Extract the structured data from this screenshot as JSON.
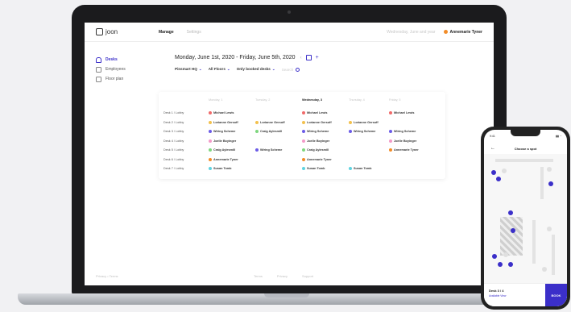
{
  "app": {
    "logo_text": "joon"
  },
  "nav": {
    "manage": "Manage",
    "settings": "Settings"
  },
  "header": {
    "faded_text": "Wednesday, June and year",
    "user_name": "Annemarie Tyner"
  },
  "sidebar": {
    "items": [
      {
        "label": "Desks"
      },
      {
        "label": "Employees"
      },
      {
        "label": "Floor plan"
      }
    ]
  },
  "footer": {
    "left": "Privacy • Terms",
    "center": [
      "Terms",
      "Privacy",
      "Support"
    ]
  },
  "main": {
    "date_range": "Monday, June 1st, 2020 - Friday, June 5th, 2020",
    "filters": [
      "Pinsmart HQ",
      "All Floors",
      "Only booked desks",
      "Search"
    ]
  },
  "table": {
    "columns": [
      "Monday, 1",
      "Tuesday, 2",
      "Wednesday, 3",
      "Thursday, 4",
      "Friday, 5"
    ],
    "rows": [
      {
        "label": "Desk 1 / Lobby",
        "cells": [
          {
            "name": "Michael Lewis",
            "color": "#f06a6a"
          },
          null,
          {
            "name": "Michael Lewis",
            "color": "#f06a6a"
          },
          null,
          {
            "name": "Michael Lewis",
            "color": "#f06a6a"
          }
        ]
      },
      {
        "label": "Desk 2 / Lobby",
        "cells": [
          {
            "name": "Lorianne Gersoff",
            "color": "#f2c14e"
          },
          {
            "name": "Lorianne Gersoff",
            "color": "#f2c14e"
          },
          {
            "name": "Lorianne Gersoff",
            "color": "#f2c14e"
          },
          {
            "name": "Lorianne Gersoff",
            "color": "#f2c14e"
          },
          null
        ]
      },
      {
        "label": "Desk 3 / Lobby",
        "cells": [
          {
            "name": "Wiring Scheme",
            "color": "#6c5ce7"
          },
          {
            "name": "Craig Aylesmill",
            "color": "#7ed67e"
          },
          {
            "name": "Wiring Scheme",
            "color": "#6c5ce7"
          },
          {
            "name": "Wiring Scheme",
            "color": "#6c5ce7"
          },
          {
            "name": "Wiring Scheme",
            "color": "#6c5ce7"
          }
        ]
      },
      {
        "label": "Desk 4 / Lobby",
        "cells": [
          {
            "name": "Joelle Boyinger",
            "color": "#f39ac8"
          },
          null,
          {
            "name": "Joelle Boyinger",
            "color": "#f39ac8"
          },
          null,
          {
            "name": "Joelle Boyinger",
            "color": "#f39ac8"
          }
        ]
      },
      {
        "label": "Desk 5 / Lobby",
        "cells": [
          {
            "name": "Craig Aylesmill",
            "color": "#7ed67e"
          },
          {
            "name": "Wiring Scheme",
            "color": "#6c5ce7"
          },
          {
            "name": "Craig Aylesmill",
            "color": "#7ed67e"
          },
          null,
          {
            "name": "Annemarie Tyner",
            "color": "#f28c28"
          }
        ]
      },
      {
        "label": "Desk 6 / Lobby",
        "cells": [
          {
            "name": "Annemarie Tyner",
            "color": "#f28c28"
          },
          null,
          {
            "name": "Annemarie Tyner",
            "color": "#f28c28"
          },
          null,
          null
        ]
      },
      {
        "label": "Desk 7 / Lobby",
        "cells": [
          {
            "name": "Susan Tomb",
            "color": "#5fd3e0"
          },
          null,
          {
            "name": "Susan Tomb",
            "color": "#5fd3e0"
          },
          {
            "name": "Susan Tomb",
            "color": "#5fd3e0"
          },
          null
        ]
      }
    ]
  },
  "phone": {
    "time": "9:41",
    "title": "Choose a spot",
    "desk_name": "Desk 3 / 4",
    "desk_sub": "Available  View",
    "book_label": "BOOK"
  },
  "colors": {
    "accent": "#3b2fc9"
  }
}
